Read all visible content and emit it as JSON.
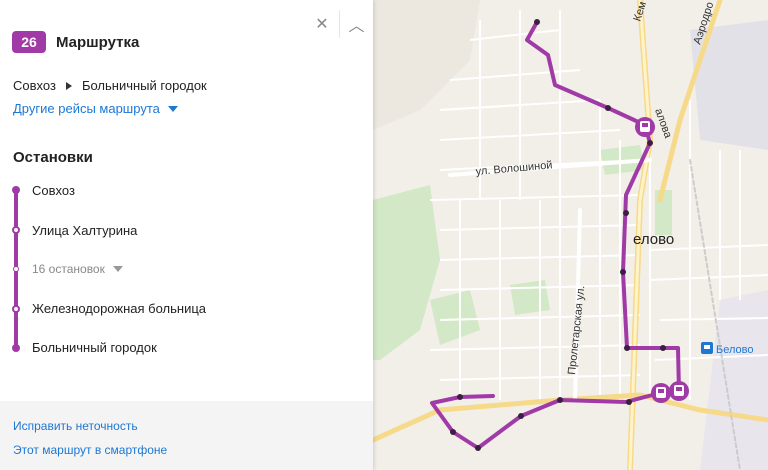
{
  "route": {
    "number": "26",
    "type": "Маршрутка",
    "from": "Совхоз",
    "to": "Больничный городок",
    "other_trips": "Другие рейсы маршрута",
    "accent": "#a03aa6"
  },
  "controls": {
    "close_icon": "close-icon",
    "collapse_icon": "chevron-up-icon"
  },
  "stops": {
    "heading": "Остановки",
    "items": [
      "Совхоз",
      "Улица Халтурина",
      "Железнодорожная больница",
      "Больничный городок"
    ],
    "collapsed_label": "16 остановок"
  },
  "footer": {
    "fix": "Исправить неточность",
    "phone": "Этот маршрут в смартфоне"
  },
  "map": {
    "labels": {
      "street1": "ул. Волошиной",
      "street2": "Пролетарская ул.",
      "street3": "Аэродро",
      "street4": "Кем",
      "street5": "алова",
      "town": "елово",
      "station": "Белово"
    },
    "colors": {
      "route": "#a03aa6",
      "land": "#f2efe8",
      "green": "#cfe6c3",
      "road": "#ffffff",
      "major_road": "#f7d98a"
    }
  }
}
